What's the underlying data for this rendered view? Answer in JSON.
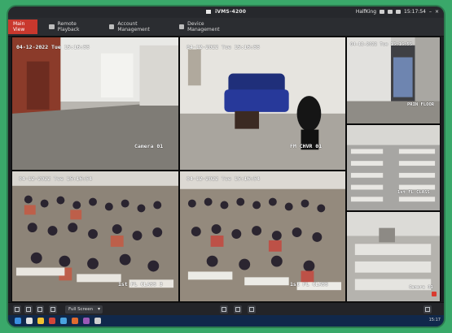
{
  "window": {
    "title": "iVMS-4200",
    "user": "HalfKing",
    "clock": "15:17:54"
  },
  "tabs": [
    {
      "label": "Main View",
      "active": true
    },
    {
      "label": "Remote Playback",
      "active": false
    },
    {
      "label": "Account Management",
      "active": false
    },
    {
      "label": "Device Management",
      "active": false
    }
  ],
  "cameras": [
    {
      "timestamp": "04-12-2022 Tue 15:16:55",
      "label": "Camera 01"
    },
    {
      "timestamp": "04-12-2022 Tue 15:16:55",
      "label": "FM CHVR 01"
    },
    {
      "timestamp": "04-12-2022 Tue 15:16:55",
      "label": "PRIN FLOOR"
    },
    {
      "timestamp": "04-12-2022 Tue 15:16:55",
      "label": "1st FL CLASS"
    },
    {
      "timestamp": "04-12-2022 Tue 15:16:54",
      "label": "1st FL CLASS 3"
    },
    {
      "timestamp": "04-12-2022 Tue 15:16:54",
      "label": "1st FL CLASS"
    },
    {
      "timestamp": "",
      "label": "Camera 01"
    }
  ],
  "toolbar": {
    "screen_mode": "Full Screen"
  },
  "taskbar": {
    "clock": "15:17"
  },
  "colors": {
    "active_tab": "#c9382d",
    "accent_frame": "#3aa86a"
  }
}
